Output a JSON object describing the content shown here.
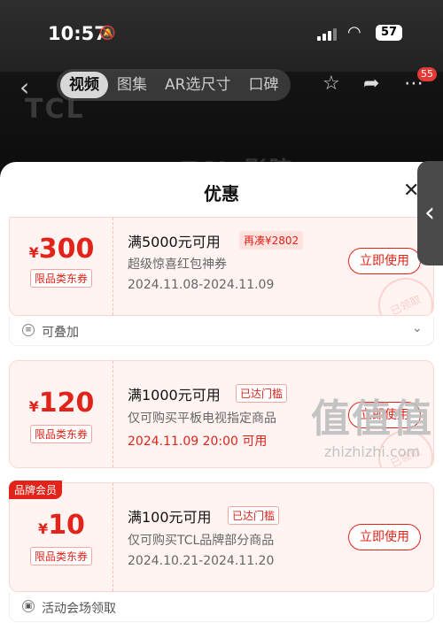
{
  "status": {
    "time": "10:57",
    "battery": "57"
  },
  "nav": {
    "logo": "TCL",
    "tabs": [
      {
        "label": "视频",
        "active": true
      },
      {
        "label": "图集"
      },
      {
        "label": "AR选尺寸"
      },
      {
        "label": "口碑"
      }
    ],
    "badge": "55",
    "promo": "TCL 影院"
  },
  "sheet": {
    "title": "优惠",
    "coupons": [
      {
        "currency": "¥",
        "amount": "300",
        "tag": "限品类东券",
        "condition": "满5000元可用",
        "pill": "再凑¥2802",
        "desc": "超级惊喜红包神券",
        "date": "2024.11.08-2024.11.09",
        "button": "立即使用",
        "stamp": "已领取"
      },
      {
        "currency": "¥",
        "amount": "120",
        "tag": "限品类东券",
        "condition": "满1000元可用",
        "pill": "已达门槛",
        "desc": "仅可购买平板电视指定商品",
        "date": "2024.11.09 20:00 可用",
        "button": "立即使用",
        "stamp": "已领取"
      },
      {
        "currency": "¥",
        "amount": "10",
        "tag": "限品类东券",
        "condition": "满100元可用",
        "pill": "已达门槛",
        "desc": "仅可购买TCL品牌部分商品",
        "date": "2024.10.21-2024.11.20",
        "button": "立即使用",
        "brand_badge": "品牌会员"
      }
    ],
    "footer1": "可叠加",
    "footer3": "活动会场领取"
  },
  "watermark": {
    "big": "值值值",
    "small": "zhizhizhi.com"
  },
  "colors": {
    "accent": "#e2231a",
    "card_bg": "#fff4f2"
  }
}
